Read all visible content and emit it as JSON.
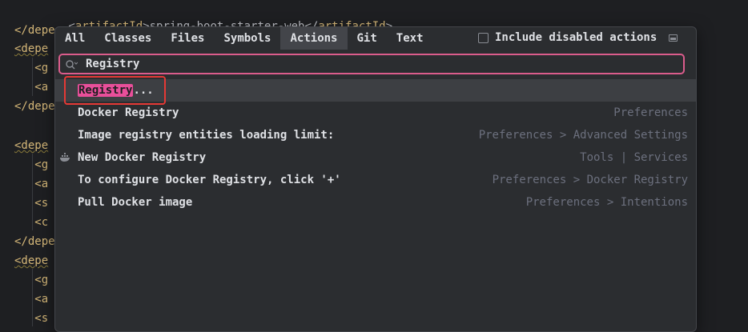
{
  "editor": {
    "lines": [
      {
        "prefix": "    <",
        "tag": "artifactId",
        "mid": ">spring-boot-starter-web</",
        "tag2": "artifactId",
        "suffix": ">"
      },
      {
        "text": "</depe"
      },
      {
        "text": "<depe"
      },
      {
        "text": "   <g"
      },
      {
        "text": "   <a"
      },
      {
        "text": "</depe"
      },
      {
        "text": "<depe"
      },
      {
        "text": "   <g"
      },
      {
        "text": "   <a"
      },
      {
        "text": "   <s"
      },
      {
        "text": "   <c"
      },
      {
        "text": "</depe"
      },
      {
        "text": "<depe"
      },
      {
        "text": "   <g"
      },
      {
        "text": "   <a"
      },
      {
        "text": "   <s"
      }
    ]
  },
  "popup": {
    "tabs": [
      {
        "label": "All"
      },
      {
        "label": "Classes"
      },
      {
        "label": "Files"
      },
      {
        "label": "Symbols"
      },
      {
        "label": "Actions"
      },
      {
        "label": "Git"
      },
      {
        "label": "Text"
      }
    ],
    "active_tab": "Actions",
    "include_disabled_label": "Include disabled actions",
    "include_disabled_checked": false,
    "search": {
      "value": "Registry"
    },
    "results": [
      {
        "highlight": "Registry",
        "rest": "...",
        "location": "",
        "selected": true,
        "icon": ""
      },
      {
        "label": "Docker Registry",
        "location": "Preferences",
        "selected": false,
        "icon": ""
      },
      {
        "label": "Image registry entities loading limit:",
        "location": "Preferences > Advanced Settings",
        "selected": false,
        "icon": ""
      },
      {
        "label": "New Docker Registry",
        "location": "Tools | Services",
        "selected": false,
        "icon": "docker-icon"
      },
      {
        "label": "To configure Docker Registry, click '+'",
        "location": "Preferences > Docker Registry",
        "selected": false,
        "icon": ""
      },
      {
        "label": "Pull Docker image",
        "location": "Preferences > Intentions",
        "selected": false,
        "icon": ""
      }
    ]
  },
  "colors": {
    "accent_pink": "#db5c8c",
    "highlight_pink": "#e84f9a",
    "callout_red": "#e53935",
    "popup_bg": "#2b2d30",
    "editor_bg": "#1e1f22"
  }
}
